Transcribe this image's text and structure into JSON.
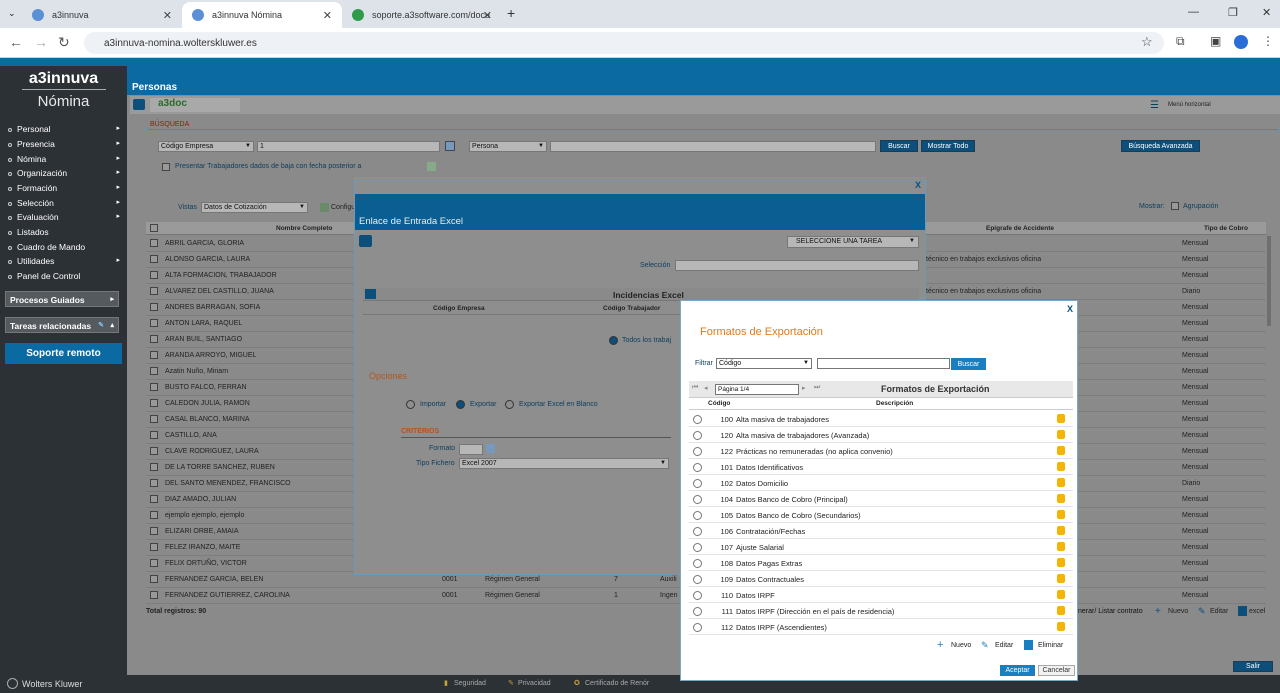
{
  "browser": {
    "tabs": [
      {
        "label": "a3innuva",
        "fav_color": "#5b8fd6"
      },
      {
        "label": "a3innuva Nómina",
        "fav_color": "#5b8fd6"
      },
      {
        "label": "soporte.a3software.com/docu",
        "fav_color": "#2e9c4a"
      }
    ],
    "url": "a3innuva-nomina.wolterskluwer.es"
  },
  "app": {
    "brand_line1": "a3innuva",
    "brand_line2": "Nómina",
    "section_title": "Personas",
    "doc_logo": "a3doc",
    "menu_horizontal": "Menú horizontal",
    "menu": [
      "Personal",
      "Presencia",
      "Nómina",
      "Organización",
      "Formación",
      "Selección",
      "Evaluación",
      "Listados",
      "Cuadro de Mando",
      "Utilidades",
      "Panel de Control"
    ],
    "procesos": "Procesos Guiados",
    "tareas": "Tareas relacionadas",
    "soporte": "Soporte remoto",
    "footer_brand": "Wolters Kluwer",
    "footer_links": [
      "Seguridad",
      "Privacidad",
      "Certificado de Renór"
    ],
    "salir": "Salir"
  },
  "search": {
    "label": "BÚSQUEDA",
    "field1": "Código Empresa",
    "field1_value": "1",
    "field2": "Persona",
    "buscar": "Buscar",
    "mostrar_todo": "Mostrar Todo",
    "avanzada": "Búsqueda Avanzada",
    "checkbox_label": "Presentar Trabajadores dados de baja con fecha posterior a"
  },
  "grid": {
    "vistas_label": "Vistas",
    "vistas_value": "Datos de Cotización",
    "config": "Configu",
    "mostrar": "Mostrar:",
    "agrupacion": "Agrupación",
    "col_nombre": "Nombre Completo",
    "col_epigrafe": "Epígrafe de Accidente",
    "col_cobro": "Tipo de Cobro",
    "rows": [
      {
        "name": "ABRIL GARCIA, GLORIA",
        "epi": "",
        "cobro": "Mensual"
      },
      {
        "name": "ALONSO GARCIA, LAURA",
        "epi": "técnico en trabajos exclusivos oficina",
        "cobro": "Mensual"
      },
      {
        "name": "ALTA FORMACION, TRABAJADOR",
        "epi": "",
        "cobro": "Mensual"
      },
      {
        "name": "ALVAREZ DEL CASTILLO, JUANA",
        "epi": "técnico en trabajos exclusivos oficina",
        "cobro": "Diario"
      },
      {
        "name": "ANDRES BARRAGAN, SOFIA",
        "epi": "",
        "cobro": "Mensual"
      },
      {
        "name": "ANTON LARA, RAQUEL",
        "epi": "",
        "cobro": "Mensual"
      },
      {
        "name": "ARAN BUIL, SANTIAGO",
        "epi": "",
        "cobro": "Mensual"
      },
      {
        "name": "ARANDA ARROYO, MIGUEL",
        "epi": "",
        "cobro": "Mensual"
      },
      {
        "name": "Azatin Nuño, Miriam",
        "epi": "",
        "cobro": "Mensual"
      },
      {
        "name": "BUSTO FALCO, FERRAN",
        "epi": "",
        "cobro": "Mensual"
      },
      {
        "name": "CALEDON JULIA, RAMON",
        "epi": "",
        "cobro": "Mensual"
      },
      {
        "name": "CASAL BLANCO, MARINA",
        "epi": "",
        "cobro": "Mensual"
      },
      {
        "name": "CASTILLO, ANA",
        "epi": "",
        "cobro": "Mensual"
      },
      {
        "name": "CLAVE RODRIGUEZ, LAURA",
        "epi": "",
        "cobro": "Mensual"
      },
      {
        "name": "DE LA TORRE SANCHEZ, RUBEN",
        "epi": "",
        "cobro": "Mensual"
      },
      {
        "name": "DEL SANTO MENENDEZ, FRANCISCO",
        "epi": "",
        "cobro": "Diario"
      },
      {
        "name": "DIAZ AMADO, JULIAN",
        "epi": "",
        "cobro": "Mensual"
      },
      {
        "name": "ejemplo ejemplo, ejemplo",
        "epi": "",
        "cobro": "Mensual"
      },
      {
        "name": "ELIZARI ORBE, AMAIA",
        "epi": "",
        "cobro": "Mensual"
      },
      {
        "name": "FELEZ IRANZO, MAITE",
        "epi": "",
        "cobro": "Mensual"
      },
      {
        "name": "FELIX ORTUÑO, VICTOR",
        "epi": "",
        "cobro": "Mensual"
      },
      {
        "name": "FERNANDEZ GARCIA, BELEN",
        "epi": "",
        "cobro": "Mensual"
      },
      {
        "name": "FERNANDEZ GUTIERREZ, CAROLINA",
        "epi": "",
        "cobro": "Mensual"
      }
    ],
    "row21_extra": {
      "code": "0001",
      "regimen": "Régimen General",
      "num": "7",
      "aux": "Auxili"
    },
    "row22_extra": {
      "code": "0001",
      "regimen": "Régimen General",
      "num": "1",
      "aux": "Ingen"
    },
    "total": "Total registros: 90",
    "act_generar": "nerar/ Listar contrato",
    "act_nuevo": "Nuevo",
    "act_editar": "Editar",
    "act_excel": "excel"
  },
  "dlg1": {
    "close": "X",
    "title": "Enlace de Entrada Excel",
    "task_select": "SELECCIONE UNA TAREA",
    "seleccion": "Selección",
    "incidencias": "Incidencias Excel",
    "col_codigo_empresa": "Código Empresa",
    "col_codigo_trabajador": "Código Trabajador",
    "todos": "Todos los trabaj",
    "opciones": "Opciones",
    "opt_importar": "Importar",
    "opt_exportar": "Exportar",
    "opt_blanco": "Exportar Excel en Blanco",
    "criterios": "CRITERIOS",
    "formato": "Formato",
    "tipo_fichero": "Tipo Fichero",
    "tipo_fichero_value": "Excel 2007"
  },
  "dlg2": {
    "close": "X",
    "title": "Formatos de Exportación",
    "filtrar": "Filtrar",
    "filtro_value": "Código",
    "buscar": "Buscar",
    "pagina": "Página 1/4",
    "grid_title": "Formatos de Exportación",
    "col_codigo": "Código",
    "col_desc": "Descripción",
    "rows": [
      {
        "code": "100",
        "desc": "Alta masiva de trabajadores"
      },
      {
        "code": "120",
        "desc": "Alta masiva de trabajadores (Avanzada)"
      },
      {
        "code": "122",
        "desc": "Prácticas no remuneradas (no aplica convenio)"
      },
      {
        "code": "101",
        "desc": "Datos Identificativos"
      },
      {
        "code": "102",
        "desc": "Datos Domicilio"
      },
      {
        "code": "104",
        "desc": "Datos Banco de Cobro (Principal)"
      },
      {
        "code": "105",
        "desc": "Datos Banco de Cobro (Secundarios)"
      },
      {
        "code": "106",
        "desc": "Contratación/Fechas"
      },
      {
        "code": "107",
        "desc": "Ajuste Salarial"
      },
      {
        "code": "108",
        "desc": "Datos Pagas Extras"
      },
      {
        "code": "109",
        "desc": "Datos Contractuales"
      },
      {
        "code": "110",
        "desc": "Datos IRPF"
      },
      {
        "code": "111",
        "desc": "Datos IRPF (Dirección en el país de residencia)"
      },
      {
        "code": "112",
        "desc": "Datos IRPF (Ascendientes)"
      }
    ],
    "nuevo": "Nuevo",
    "editar": "Editar",
    "eliminar": "Eliminar",
    "aceptar": "Aceptar",
    "cancelar": "Cancelar"
  }
}
